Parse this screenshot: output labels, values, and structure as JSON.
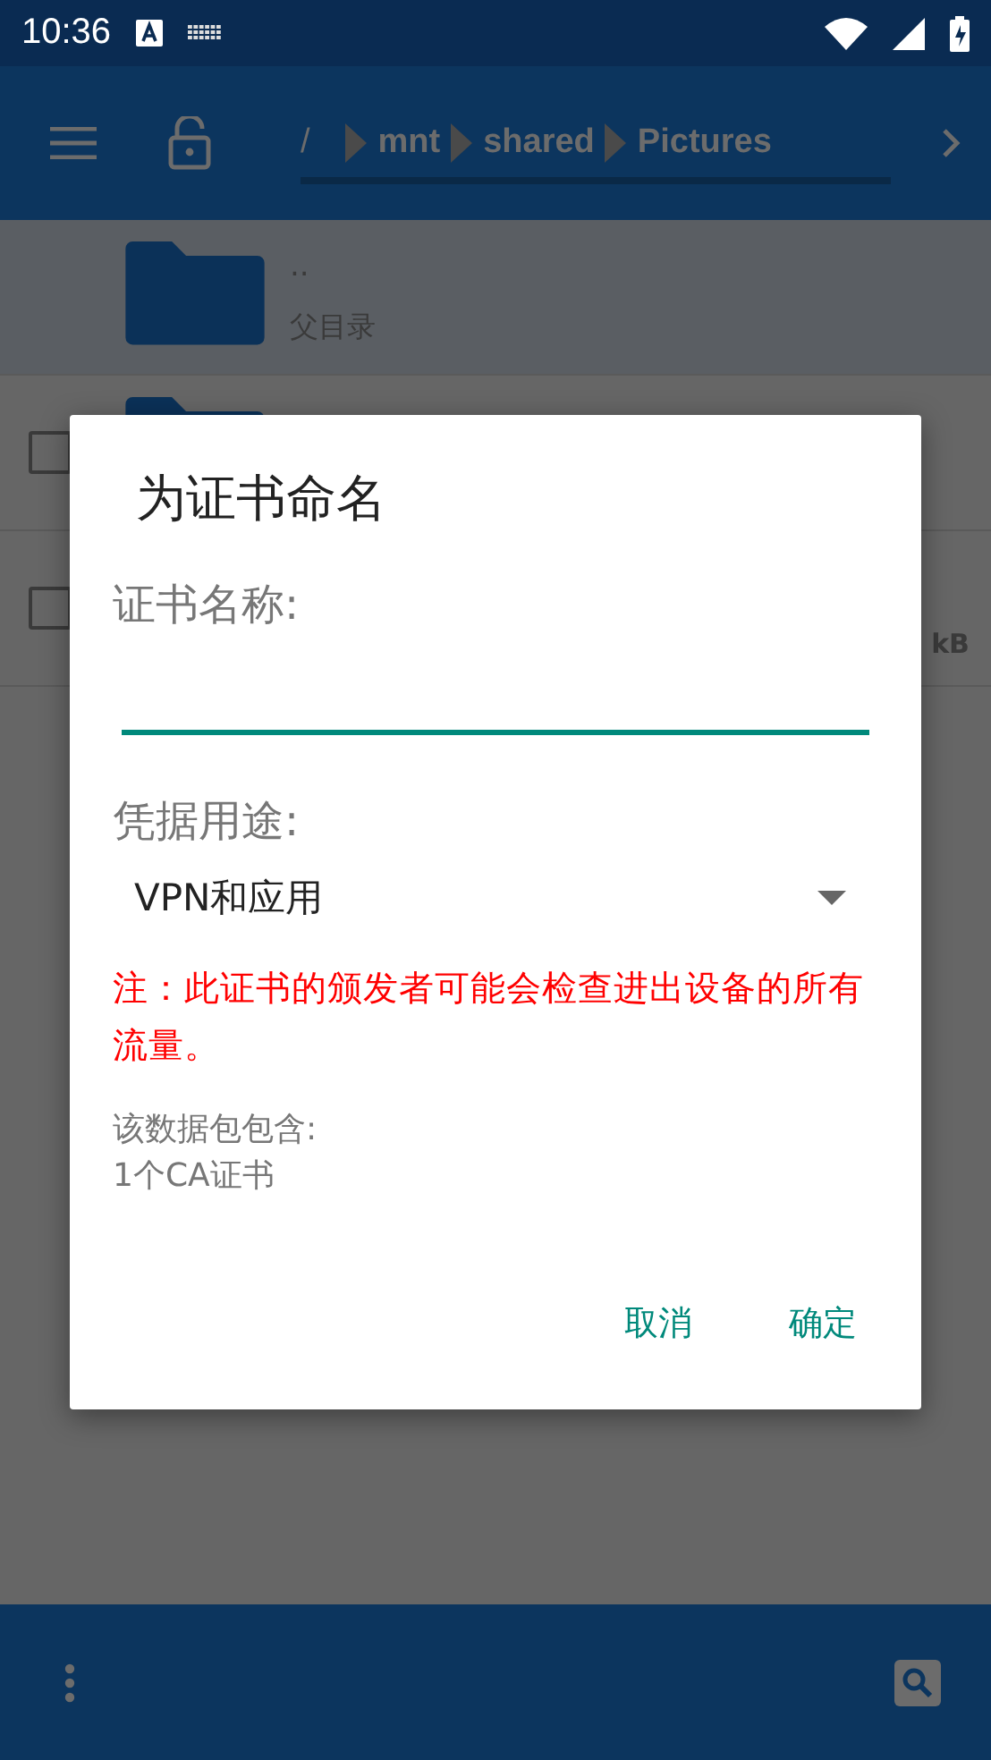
{
  "status_bar": {
    "time": "10:36"
  },
  "toolbar": {
    "breadcrumb": [
      {
        "label": "/"
      },
      {
        "label": "mnt"
      },
      {
        "label": "shared"
      },
      {
        "label": "Pictures"
      }
    ]
  },
  "files": [
    {
      "kind": "parent",
      "name": "..",
      "detail": "父目录",
      "selected": true
    },
    {
      "kind": "folder",
      "selected": false,
      "checked": false
    },
    {
      "kind": "file",
      "size": "kB",
      "selected": false,
      "checked": false
    }
  ],
  "dialog": {
    "title": "为证书命名",
    "name_label": "证书名称:",
    "usage_label": "凭据用途:",
    "usage_value": "VPN和应用",
    "warning": "注：此证书的颁发者可能会检查进出设备的所有流量。",
    "contents_label": "该数据包包含:",
    "contents_value": "1个CA证书",
    "buttons": [
      "取消",
      "确定"
    ]
  }
}
